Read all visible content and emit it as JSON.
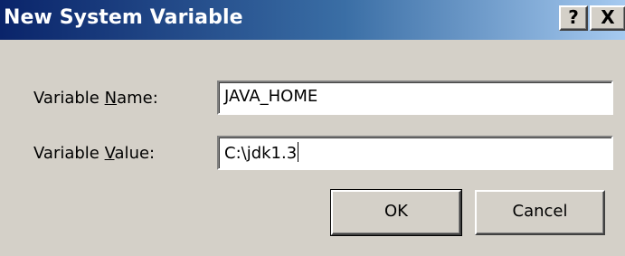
{
  "window": {
    "title": "New System Variable",
    "help_button": "?",
    "close_button": "X"
  },
  "form": {
    "name_label_prefix": "Variable ",
    "name_label_accel": "N",
    "name_label_suffix": "ame:",
    "name_value": "JAVA_HOME",
    "value_label_prefix": "Variable ",
    "value_label_accel": "V",
    "value_label_suffix": "alue:",
    "value_value": "C:\\jdk1.3"
  },
  "buttons": {
    "ok": "OK",
    "cancel": "Cancel"
  }
}
